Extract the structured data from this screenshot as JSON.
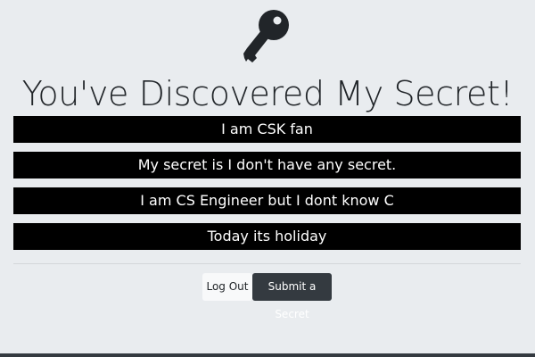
{
  "header": {
    "icon": "key-icon",
    "title": "You've Discovered My Secret!"
  },
  "secrets": [
    {
      "text": "I am CSK fan"
    },
    {
      "text": "My secret is I don't have any secret."
    },
    {
      "text": "I am CS Engineer but I dont know C"
    },
    {
      "text": "Today its holiday"
    }
  ],
  "actions": {
    "logout_label": "Log Out",
    "submit_label": "Submit a Secret"
  },
  "colors": {
    "background": "#e9ecef",
    "secret_bar": "#000000",
    "secret_text": "#ffffff",
    "logout_button": "#f8f9fa",
    "submit_button": "#343a40"
  }
}
